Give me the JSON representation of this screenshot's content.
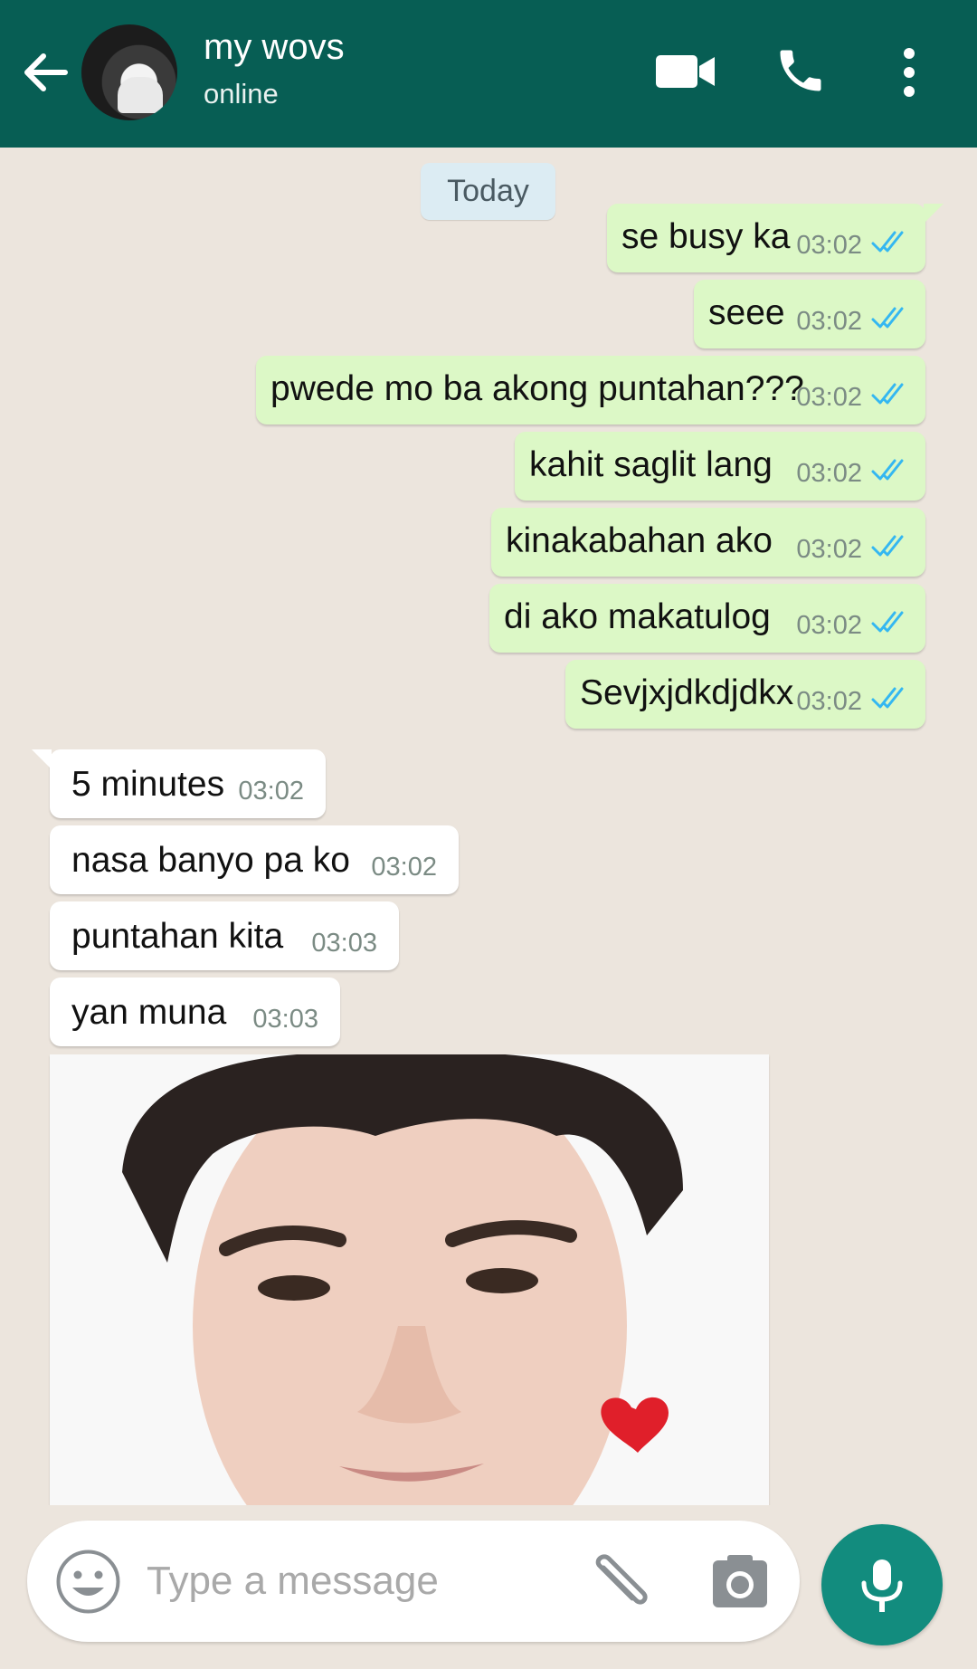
{
  "header": {
    "contact_name": "my wovs",
    "status": "online",
    "icons": [
      "back-arrow-icon",
      "video-call-icon",
      "phone-icon",
      "more-vert-icon"
    ]
  },
  "chat": {
    "date_label": "Today",
    "outgoing": [
      {
        "text": "se busy ka",
        "time": "03:02"
      },
      {
        "text": "seee",
        "time": "03:02"
      },
      {
        "text": "pwede mo ba akong puntahan???",
        "time": "03:02"
      },
      {
        "text": "kahit saglit lang",
        "time": "03:02"
      },
      {
        "text": "kinakabahan ako",
        "time": "03:02"
      },
      {
        "text": "di ako makatulog",
        "time": "03:02"
      },
      {
        "text": "Sevjxjdkdjdkx",
        "time": "03:02"
      }
    ],
    "incoming": [
      {
        "text": "5 minutes",
        "time": "03:02"
      },
      {
        "text": "nasa banyo pa ko",
        "time": "03:02"
      },
      {
        "text": "puntahan kita",
        "time": "03:03"
      },
      {
        "text": "yan muna",
        "time": "03:03"
      }
    ],
    "photo_message": {
      "icon": "photo-message",
      "sticker": "heart-icon"
    }
  },
  "composer": {
    "placeholder": "Type a message",
    "icons": [
      "emoji-icon",
      "attach-icon",
      "camera-icon",
      "mic-icon"
    ]
  },
  "colors": {
    "header": "#075e54",
    "outgoing_bubble": "#dcf8c6",
    "incoming_bubble": "#ffffff",
    "read_ticks": "#34b7f1",
    "mic_button": "#128c7e"
  }
}
